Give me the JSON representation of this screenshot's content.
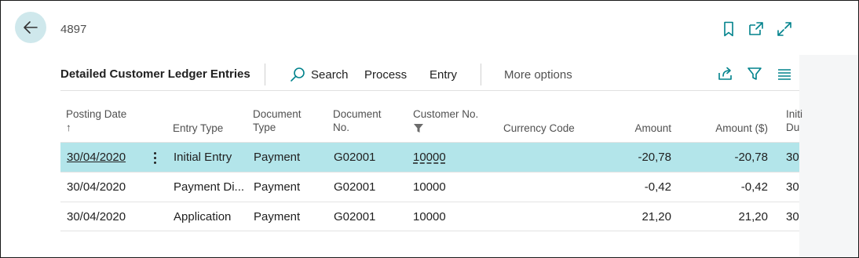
{
  "header": {
    "record_title": "4897"
  },
  "page": {
    "title": "Detailed Customer Ledger Entries",
    "actions": {
      "search": "Search",
      "process": "Process",
      "entry": "Entry",
      "more": "More options"
    }
  },
  "table": {
    "columns": {
      "posting_date": "Posting Date",
      "posting_date_sort": "↑",
      "entry_type": "Entry Type",
      "document_type_1": "Document",
      "document_type_2": "Type",
      "document_no_1": "Document",
      "document_no_2": "No.",
      "customer_no": "Customer No.",
      "currency_code": "Currency Code",
      "amount": "Amount",
      "amount_lcy": "Amount ($)",
      "initial_1": "Initi",
      "initial_2": "Du"
    },
    "rows": [
      {
        "posting_date": "30/04/2020",
        "entry_type": "Initial Entry",
        "document_type": "Payment",
        "document_no": "G02001",
        "customer_no": "10000",
        "currency_code": "",
        "amount": "-20,78",
        "amount_lcy": "-20,78",
        "initial_due": "30"
      },
      {
        "posting_date": "30/04/2020",
        "entry_type": "Payment Di...",
        "document_type": "Payment",
        "document_no": "G02001",
        "customer_no": "10000",
        "currency_code": "",
        "amount": "-0,42",
        "amount_lcy": "-0,42",
        "initial_due": "30"
      },
      {
        "posting_date": "30/04/2020",
        "entry_type": "Application",
        "document_type": "Payment",
        "document_no": "G02001",
        "customer_no": "10000",
        "currency_code": "",
        "amount": "21,20",
        "amount_lcy": "21,20",
        "initial_due": "30"
      }
    ]
  },
  "colors": {
    "accent": "#00828c",
    "selected_row": "#b3e5ea",
    "back_button": "#cfe8ec",
    "page_background": "#f5f6f7"
  },
  "icons": {
    "back": "arrow-left-icon",
    "bookmark": "bookmark-icon",
    "open_new": "open-new-window-icon",
    "expand": "expand-icon",
    "search": "search-icon",
    "share": "share-icon",
    "filter": "filter-icon",
    "list": "list-view-icon"
  }
}
